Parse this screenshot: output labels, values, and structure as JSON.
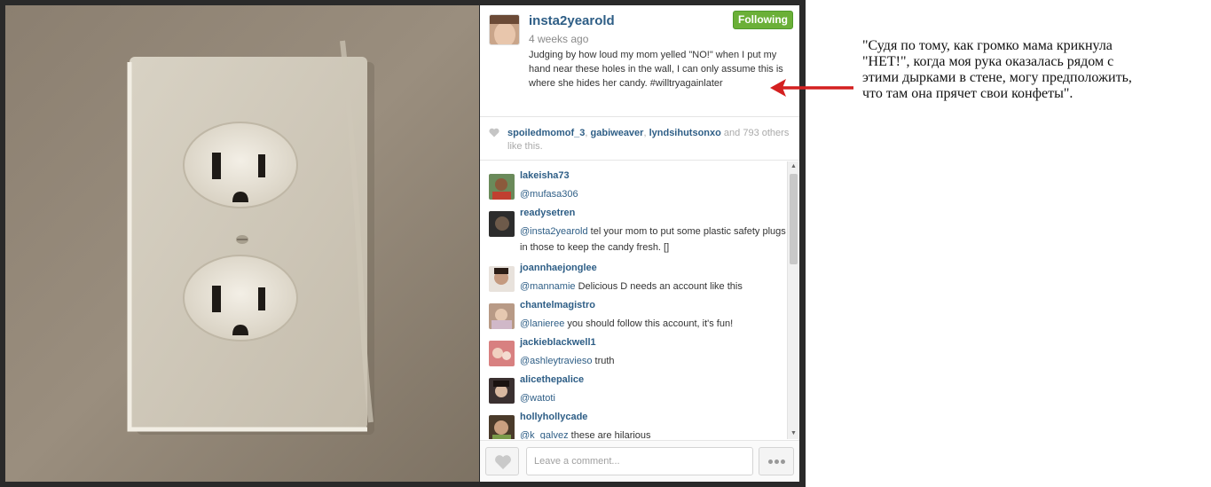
{
  "post": {
    "username": "insta2yearold",
    "time_ago": "4 weeks ago",
    "follow_label": "Following",
    "caption": "Judging by how loud my mom yelled \"NO!\" when I put my hand near these holes in the wall, I can only assume this is where she hides her candy. #willtryagainlater"
  },
  "likes": {
    "users": [
      "spoiledmomof_3",
      "gabiweaver",
      "lyndsihutsonxo"
    ],
    "separator": ", ",
    "suffix_and": " and ",
    "count": "793",
    "suffix_tail": " others like this."
  },
  "comments": [
    {
      "username": "lakeisha73",
      "mention": "@mufasa306",
      "text": ""
    },
    {
      "username": "readysetren",
      "mention": "@insta2yearold",
      "text": " tel your mom to put some plastic safety plugs in those to keep the candy fresh. []"
    },
    {
      "username": "joannhaejonglee",
      "mention": "@mannamie",
      "text": " Delicious D needs an account like this"
    },
    {
      "username": "chantelmagistro",
      "mention": "@lanieree",
      "text": " you should follow this account, it's fun!"
    },
    {
      "username": "jackieblackwell1",
      "mention": "@ashleytravieso",
      "text": " truth"
    },
    {
      "username": "alicethepalice",
      "mention": "@watoti",
      "text": ""
    },
    {
      "username": "hollyhollycade",
      "mention": "@k_galvez",
      "text": " these are hilarious"
    }
  ],
  "composer": {
    "placeholder": "Leave a comment..."
  },
  "annotation": {
    "translation": "\"Судя по тому, как громко мама крикнула\n\"НЕТ!\", когда моя рука оказалась рядом с\nэтими дырками в стене, могу предположить,\nчто там она прячет свои конфеты\"."
  },
  "colors": {
    "link": "#2e5e86",
    "follow_green": "#6bb038",
    "arrow_red": "#d42020"
  },
  "icons": [
    "heart-icon",
    "more-dots-icon",
    "scroll-arrow-up",
    "scroll-arrow-down",
    "red-arrow"
  ]
}
